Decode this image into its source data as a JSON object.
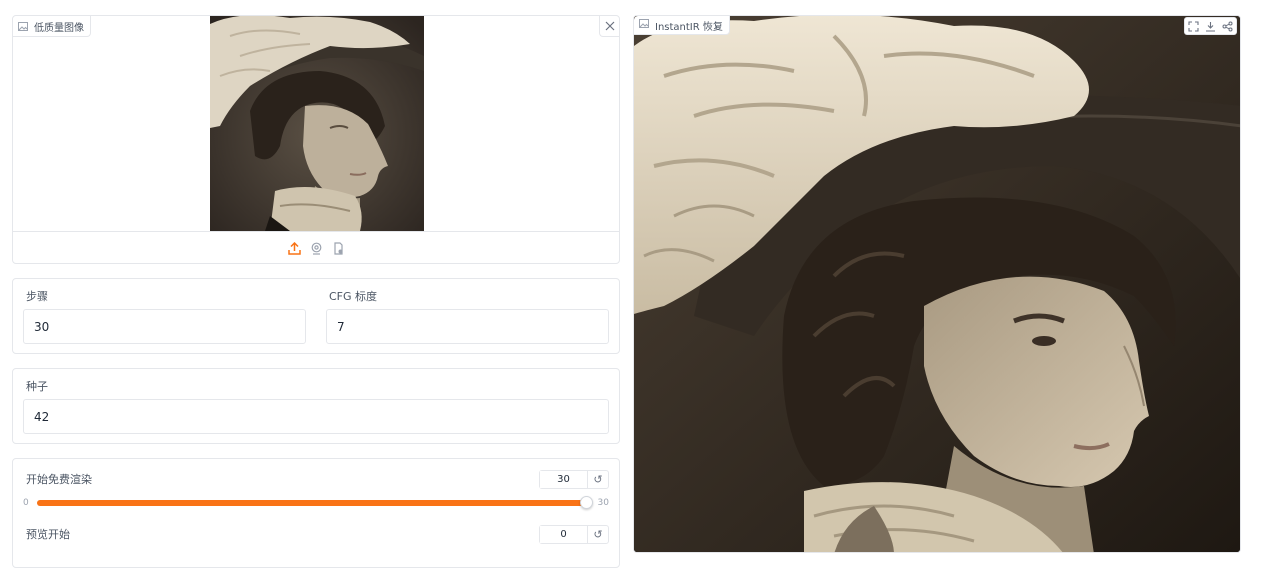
{
  "input_image": {
    "label": "低质量图像",
    "icons": [
      "image-icon",
      "close-icon",
      "upload-icon",
      "webcam-icon",
      "clipboard-icon"
    ],
    "accent": "#f97316"
  },
  "params": {
    "steps": {
      "label": "步骤",
      "value": "30"
    },
    "cfg": {
      "label": "CFG 标度",
      "value": "7"
    },
    "seed": {
      "label": "种子",
      "value": "42"
    }
  },
  "sliders": {
    "free_render": {
      "label": "开始免费渲染",
      "value": "30",
      "min": "0",
      "max": "30",
      "fraction": 1.0,
      "reset_icon": "↺"
    },
    "preview_start": {
      "label": "预览开始",
      "value": "0",
      "reset_icon": "↺"
    }
  },
  "output_image": {
    "label": "InstantIR 恢复",
    "icons": [
      "fullscreen-icon",
      "download-icon",
      "share-icon"
    ]
  }
}
